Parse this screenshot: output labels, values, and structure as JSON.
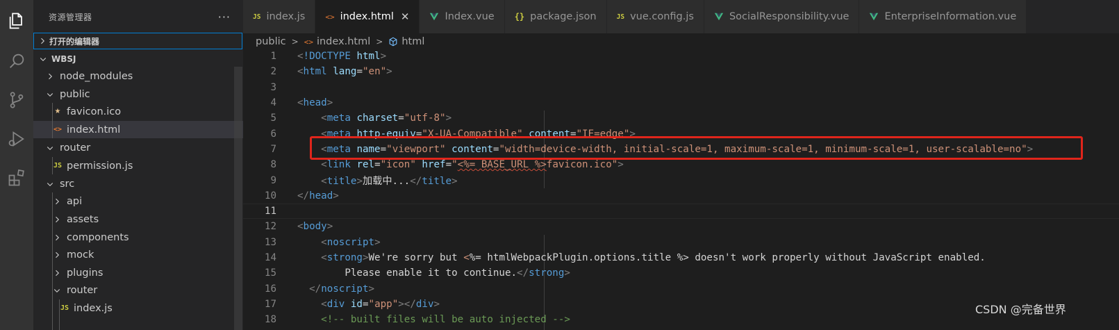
{
  "sidebar": {
    "title": "资源管理器",
    "more": "···",
    "open_editors": "打开的编辑器",
    "project": "WBSJ",
    "tree": [
      {
        "label": "node_modules",
        "type": "folder",
        "expanded": false
      },
      {
        "label": "public",
        "type": "folder",
        "expanded": true
      },
      {
        "label": "favicon.ico",
        "type": "favicon"
      },
      {
        "label": "index.html",
        "type": "html",
        "selected": true
      },
      {
        "label": "router",
        "type": "folder",
        "expanded": true
      },
      {
        "label": "permission.js",
        "type": "js"
      },
      {
        "label": "src",
        "type": "folder",
        "expanded": true
      },
      {
        "label": "api",
        "type": "folder",
        "expanded": false
      },
      {
        "label": "assets",
        "type": "folder",
        "expanded": false
      },
      {
        "label": "components",
        "type": "folder",
        "expanded": false
      },
      {
        "label": "mock",
        "type": "folder",
        "expanded": false
      },
      {
        "label": "plugins",
        "type": "folder",
        "expanded": false
      },
      {
        "label": "router",
        "type": "folder",
        "expanded": true
      },
      {
        "label": "index.js",
        "type": "js"
      }
    ]
  },
  "tabs": [
    {
      "label": "index.js",
      "icon": "js-icon",
      "badge": "JS"
    },
    {
      "label": "index.html",
      "icon": "html-icon",
      "active": true,
      "close": "✕"
    },
    {
      "label": "Index.vue",
      "icon": "vue-icon"
    },
    {
      "label": "package.json",
      "icon": "json-icon",
      "badge": "{}"
    },
    {
      "label": "vue.config.js",
      "icon": "js-icon",
      "badge": "JS"
    },
    {
      "label": "SocialResponsibility.vue",
      "icon": "vue-icon"
    },
    {
      "label": "EnterpriseInformation.vue",
      "icon": "vue-icon"
    }
  ],
  "breadcrumb": {
    "folder": "public",
    "file": "index.html",
    "symbol": "html"
  },
  "editor": {
    "current_line": 11,
    "highlight_color": "#e0251b",
    "lines": [
      {
        "n": "1",
        "tokens": [
          [
            "t-br",
            "<"
          ],
          [
            "t-doc",
            "!DOCTYPE"
          ],
          [
            "t-txt",
            " "
          ],
          [
            "t-attr",
            "html"
          ],
          [
            "t-br",
            ">"
          ]
        ]
      },
      {
        "n": "2",
        "tokens": [
          [
            "t-br",
            "<"
          ],
          [
            "t-tag",
            "html"
          ],
          [
            "t-txt",
            " "
          ],
          [
            "t-attr",
            "lang"
          ],
          [
            "t-txt",
            "="
          ],
          [
            "t-str",
            "\"en\""
          ],
          [
            "t-br",
            ">"
          ]
        ]
      },
      {
        "n": "3",
        "tokens": []
      },
      {
        "n": "4",
        "tokens": [
          [
            "t-br",
            "<"
          ],
          [
            "t-tag",
            "head"
          ],
          [
            "t-br",
            ">"
          ]
        ]
      },
      {
        "n": "5",
        "tokens": [
          [
            "t-txt",
            "    "
          ],
          [
            "t-br",
            "<"
          ],
          [
            "t-tag",
            "meta"
          ],
          [
            "t-txt",
            " "
          ],
          [
            "t-attr",
            "charset"
          ],
          [
            "t-txt",
            "="
          ],
          [
            "t-str",
            "\"utf-8\""
          ],
          [
            "t-br",
            ">"
          ]
        ]
      },
      {
        "n": "6",
        "tokens": [
          [
            "t-txt",
            "    "
          ],
          [
            "t-br",
            "<"
          ],
          [
            "t-tag",
            "meta"
          ],
          [
            "t-txt",
            " "
          ],
          [
            "t-attr",
            "http-equiv"
          ],
          [
            "t-txt",
            "="
          ],
          [
            "t-str",
            "\"X-UA-Compatible\""
          ],
          [
            "t-txt",
            " "
          ],
          [
            "t-attr",
            "content"
          ],
          [
            "t-txt",
            "="
          ],
          [
            "t-str",
            "\"IE=edge\""
          ],
          [
            "t-br",
            ">"
          ]
        ]
      },
      {
        "n": "7",
        "tokens": [
          [
            "t-txt",
            "    "
          ],
          [
            "t-br",
            "<"
          ],
          [
            "t-tag",
            "meta"
          ],
          [
            "t-txt",
            " "
          ],
          [
            "t-attr",
            "name"
          ],
          [
            "t-txt",
            "="
          ],
          [
            "t-str",
            "\"viewport\""
          ],
          [
            "t-txt",
            " "
          ],
          [
            "t-attr",
            "content"
          ],
          [
            "t-txt",
            "="
          ],
          [
            "t-str",
            "\"width=device-width, initial-scale=1, maximum-scale=1, minimum-scale=1, user-scalable=no\""
          ],
          [
            "t-br",
            ">"
          ]
        ]
      },
      {
        "n": "8",
        "tokens": [
          [
            "t-txt",
            "    "
          ],
          [
            "t-br",
            "<"
          ],
          [
            "t-tag",
            "link"
          ],
          [
            "t-txt",
            " "
          ],
          [
            "t-attr",
            "rel"
          ],
          [
            "t-txt",
            "="
          ],
          [
            "t-str",
            "\"icon\""
          ],
          [
            "t-txt",
            " "
          ],
          [
            "t-attr",
            "href"
          ],
          [
            "t-txt",
            "="
          ],
          [
            "t-str",
            "\""
          ],
          [
            "t-tmpl",
            "<%= BASE_URL %>"
          ],
          [
            "t-str",
            "favicon.ico\""
          ],
          [
            "t-br",
            ">"
          ]
        ]
      },
      {
        "n": "9",
        "tokens": [
          [
            "t-txt",
            "    "
          ],
          [
            "t-br",
            "<"
          ],
          [
            "t-tag",
            "title"
          ],
          [
            "t-br",
            ">"
          ],
          [
            "t-txt",
            "加载中..."
          ],
          [
            "t-br",
            "</"
          ],
          [
            "t-tag",
            "title"
          ],
          [
            "t-br",
            ">"
          ]
        ]
      },
      {
        "n": "10",
        "tokens": [
          [
            "t-br",
            "</"
          ],
          [
            "t-tag",
            "head"
          ],
          [
            "t-br",
            ">"
          ]
        ]
      },
      {
        "n": "11",
        "tokens": []
      },
      {
        "n": "12",
        "tokens": [
          [
            "t-br",
            "<"
          ],
          [
            "t-tag",
            "body"
          ],
          [
            "t-br",
            ">"
          ]
        ]
      },
      {
        "n": "13",
        "tokens": [
          [
            "t-txt",
            "    "
          ],
          [
            "t-br",
            "<"
          ],
          [
            "t-tag",
            "noscript"
          ],
          [
            "t-br",
            ">"
          ]
        ]
      },
      {
        "n": "14",
        "tokens": [
          [
            "t-txt",
            "    "
          ],
          [
            "t-br",
            "<"
          ],
          [
            "t-tag",
            "strong"
          ],
          [
            "t-br",
            ">"
          ],
          [
            "t-txt",
            "We're sorry but "
          ],
          [
            "t-str",
            "<"
          ],
          [
            "t-txt",
            "%= htmlWebpackPlugin.options.title %> doesn't work properly without JavaScript enabled."
          ]
        ]
      },
      {
        "n": "15",
        "tokens": [
          [
            "t-txt",
            "        Please enable it to continue."
          ],
          [
            "t-br",
            "</"
          ],
          [
            "t-tag",
            "strong"
          ],
          [
            "t-br",
            ">"
          ]
        ]
      },
      {
        "n": "16",
        "tokens": [
          [
            "t-txt",
            "  "
          ],
          [
            "t-br",
            "</"
          ],
          [
            "t-tag",
            "noscript"
          ],
          [
            "t-br",
            ">"
          ]
        ]
      },
      {
        "n": "17",
        "tokens": [
          [
            "t-txt",
            "    "
          ],
          [
            "t-br",
            "<"
          ],
          [
            "t-tag",
            "div"
          ],
          [
            "t-txt",
            " "
          ],
          [
            "t-attr",
            "id"
          ],
          [
            "t-txt",
            "="
          ],
          [
            "t-str",
            "\"app\""
          ],
          [
            "t-br",
            "></"
          ],
          [
            "t-tag",
            "div"
          ],
          [
            "t-br",
            ">"
          ]
        ]
      },
      {
        "n": "18",
        "tokens": [
          [
            "t-txt",
            "    "
          ],
          [
            "t-com",
            "<!-- built files will be auto injected -->"
          ]
        ]
      }
    ]
  },
  "watermark": "CSDN @完备世界"
}
